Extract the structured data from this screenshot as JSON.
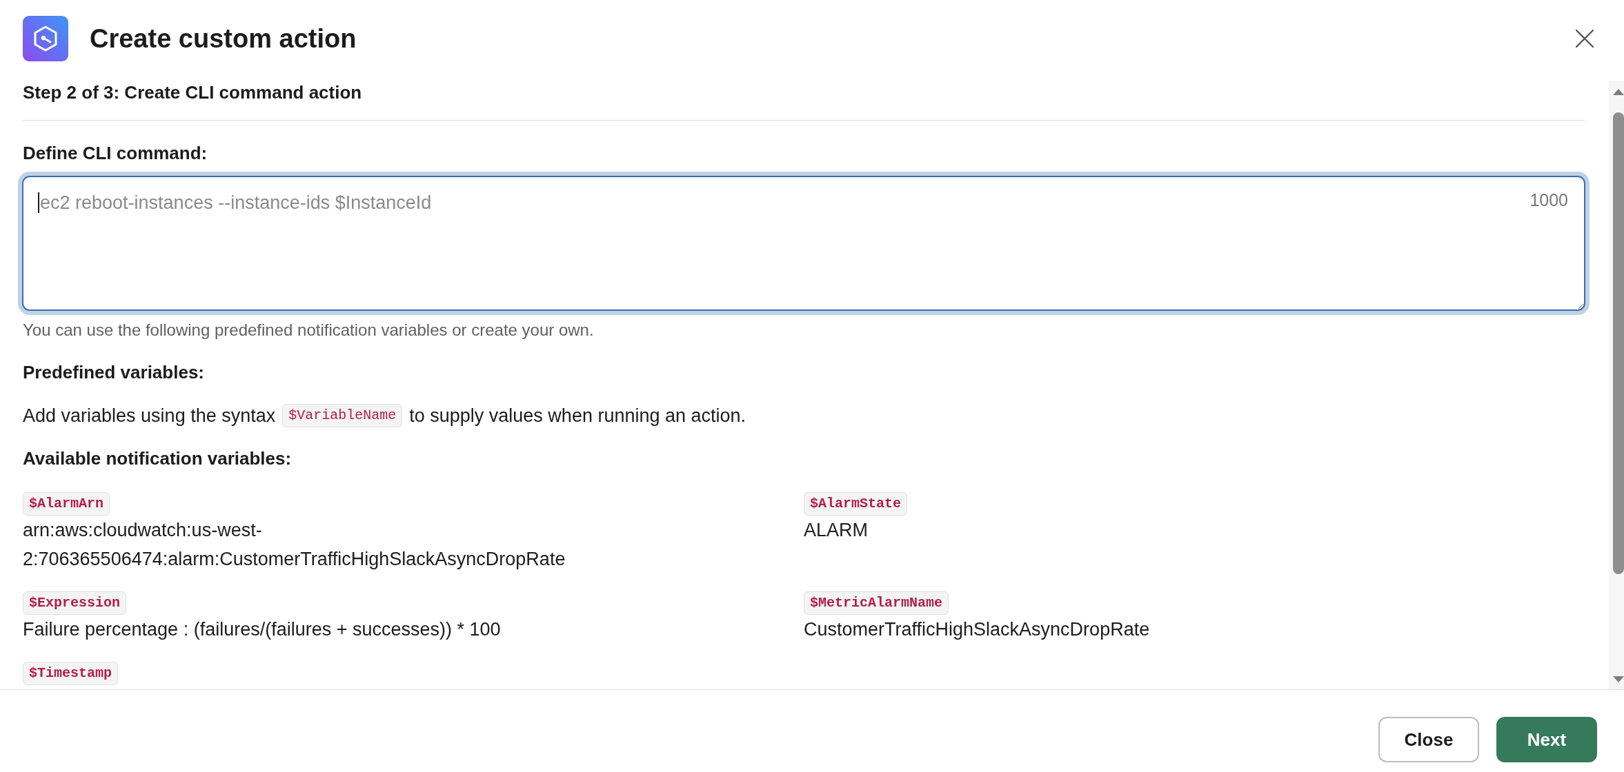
{
  "dialog": {
    "title": "Create custom action",
    "step": "Step 2 of 3: Create CLI command action"
  },
  "command": {
    "label": "Define CLI command:",
    "placeholder": "ec2 reboot-instances --instance-ids $InstanceId",
    "character_count": "1000",
    "focused": true,
    "hint": "You can use the following predefined notification variables or create your own."
  },
  "predefined": {
    "heading": "Predefined variables:",
    "text_before": "Add variables using the syntax",
    "code": "$VariableName",
    "text_after": "to supply values when running an action."
  },
  "available": {
    "heading": "Available notification variables:",
    "variables": [
      {
        "name": "$AlarmArn",
        "value": "arn:aws:cloudwatch:us-west-2:706365506474:alarm:CustomerTrafficHighSlackAsyncDropRate"
      },
      {
        "name": "$AlarmState",
        "value": "ALARM"
      },
      {
        "name": "$Expression",
        "value": "Failure percentage : (failures/(failures + successes)) * 100"
      },
      {
        "name": "$MetricAlarmName",
        "value": "CustomerTrafficHighSlackAsyncDropRate"
      },
      {
        "name": "$Timestamp"
      }
    ]
  },
  "buttons": [
    {
      "label": "Close",
      "kind": "secondary"
    },
    {
      "label": "Next",
      "kind": "primary"
    }
  ]
}
